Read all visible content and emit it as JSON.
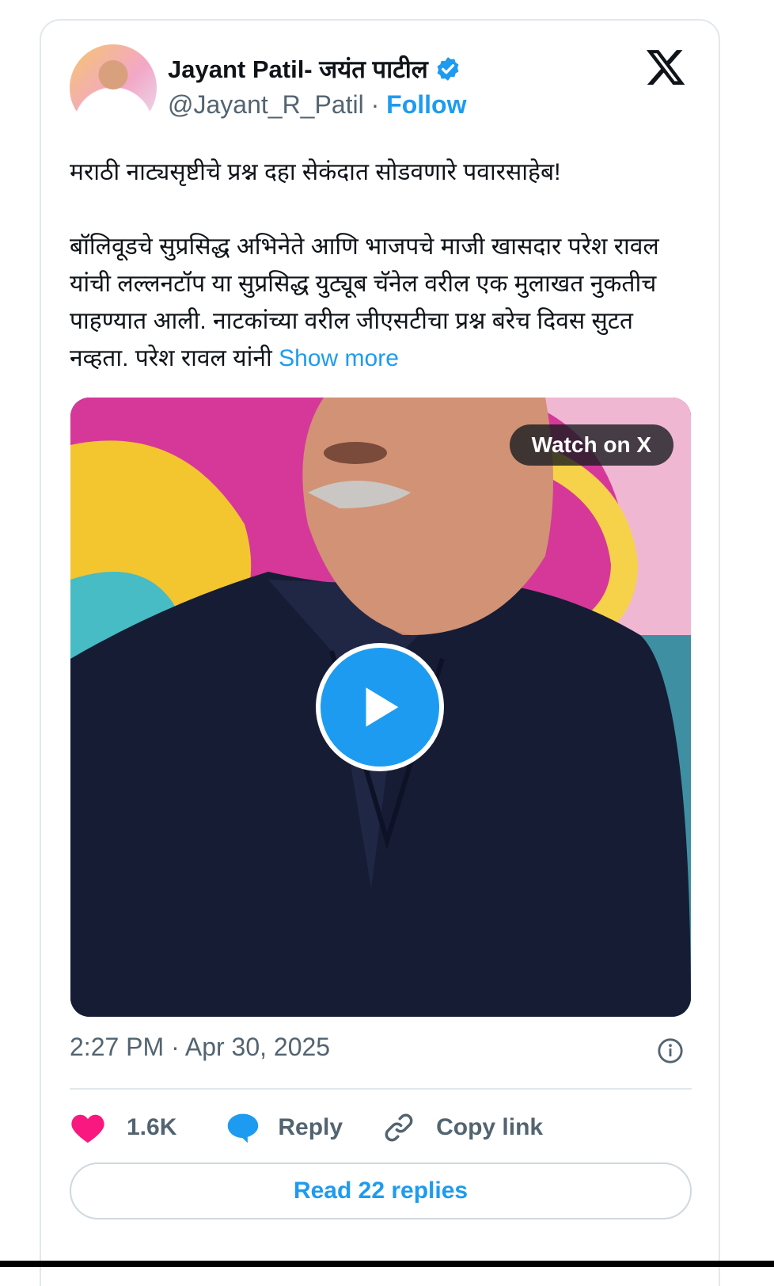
{
  "author": {
    "name": "Jayant Patil- जयंत पाटील",
    "handle": "@Jayant_R_Patil",
    "separator": "·",
    "follow_label": "Follow",
    "verified": true
  },
  "tweet": {
    "paragraph1": "मराठी नाट्यसृष्टीचे प्रश्न दहा सेकंदात सोडवणारे पवारसाहेब!",
    "paragraph2": "बॉलिवूडचे सुप्रसिद्ध अभिनेते आणि भाजपचे माजी खासदार परेश रावल यांची लल्लनटॉप या सुप्रसिद्ध युट्यूब चॅनेल वरील एक मुलाखत नुकतीच पाहण्यात आली. नाटकांच्या वरील जीएसटीचा प्रश्न बरेच दिवस सुटत नव्हता. परेश रावल यांनी",
    "show_more": "Show more"
  },
  "media": {
    "watch_label": "Watch on X",
    "type": "video"
  },
  "meta": {
    "timestamp": "2:27 PM · Apr 30, 2025"
  },
  "actions": {
    "likes": "1.6K",
    "reply_label": "Reply",
    "copy_link_label": "Copy link"
  },
  "read_replies_label": "Read 22 replies",
  "colors": {
    "accent": "#1d9bf0",
    "like": "#f91880",
    "secondary_text": "#536471"
  },
  "icons": [
    "verified-badge-icon",
    "x-logo-icon",
    "play-icon",
    "info-icon",
    "heart-icon",
    "reply-bubble-icon",
    "link-icon"
  ]
}
